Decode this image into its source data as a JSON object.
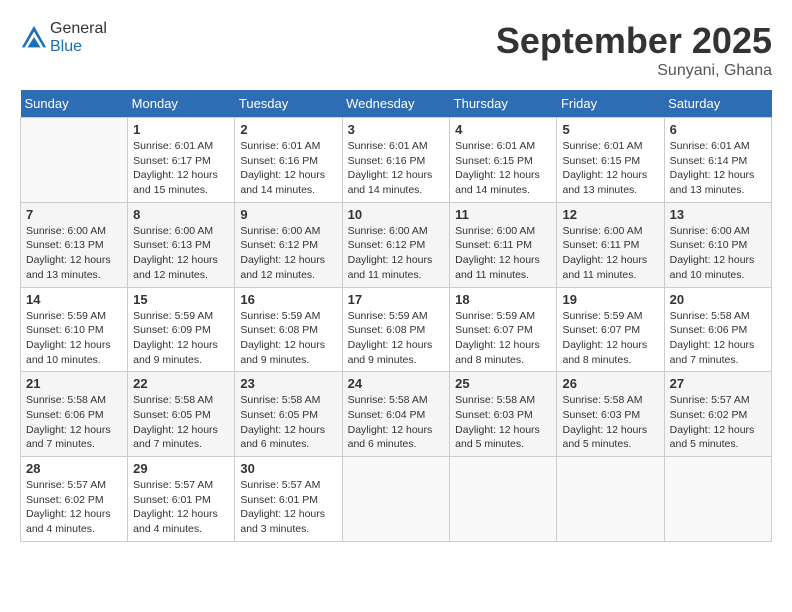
{
  "header": {
    "logo_general": "General",
    "logo_blue": "Blue",
    "month_title": "September 2025",
    "location": "Sunyani, Ghana"
  },
  "days_of_week": [
    "Sunday",
    "Monday",
    "Tuesday",
    "Wednesday",
    "Thursday",
    "Friday",
    "Saturday"
  ],
  "weeks": [
    [
      {
        "num": "",
        "sunrise": "",
        "sunset": "",
        "daylight": ""
      },
      {
        "num": "1",
        "sunrise": "Sunrise: 6:01 AM",
        "sunset": "Sunset: 6:17 PM",
        "daylight": "Daylight: 12 hours and 15 minutes."
      },
      {
        "num": "2",
        "sunrise": "Sunrise: 6:01 AM",
        "sunset": "Sunset: 6:16 PM",
        "daylight": "Daylight: 12 hours and 14 minutes."
      },
      {
        "num": "3",
        "sunrise": "Sunrise: 6:01 AM",
        "sunset": "Sunset: 6:16 PM",
        "daylight": "Daylight: 12 hours and 14 minutes."
      },
      {
        "num": "4",
        "sunrise": "Sunrise: 6:01 AM",
        "sunset": "Sunset: 6:15 PM",
        "daylight": "Daylight: 12 hours and 14 minutes."
      },
      {
        "num": "5",
        "sunrise": "Sunrise: 6:01 AM",
        "sunset": "Sunset: 6:15 PM",
        "daylight": "Daylight: 12 hours and 13 minutes."
      },
      {
        "num": "6",
        "sunrise": "Sunrise: 6:01 AM",
        "sunset": "Sunset: 6:14 PM",
        "daylight": "Daylight: 12 hours and 13 minutes."
      }
    ],
    [
      {
        "num": "7",
        "sunrise": "Sunrise: 6:00 AM",
        "sunset": "Sunset: 6:13 PM",
        "daylight": "Daylight: 12 hours and 13 minutes."
      },
      {
        "num": "8",
        "sunrise": "Sunrise: 6:00 AM",
        "sunset": "Sunset: 6:13 PM",
        "daylight": "Daylight: 12 hours and 12 minutes."
      },
      {
        "num": "9",
        "sunrise": "Sunrise: 6:00 AM",
        "sunset": "Sunset: 6:12 PM",
        "daylight": "Daylight: 12 hours and 12 minutes."
      },
      {
        "num": "10",
        "sunrise": "Sunrise: 6:00 AM",
        "sunset": "Sunset: 6:12 PM",
        "daylight": "Daylight: 12 hours and 11 minutes."
      },
      {
        "num": "11",
        "sunrise": "Sunrise: 6:00 AM",
        "sunset": "Sunset: 6:11 PM",
        "daylight": "Daylight: 12 hours and 11 minutes."
      },
      {
        "num": "12",
        "sunrise": "Sunrise: 6:00 AM",
        "sunset": "Sunset: 6:11 PM",
        "daylight": "Daylight: 12 hours and 11 minutes."
      },
      {
        "num": "13",
        "sunrise": "Sunrise: 6:00 AM",
        "sunset": "Sunset: 6:10 PM",
        "daylight": "Daylight: 12 hours and 10 minutes."
      }
    ],
    [
      {
        "num": "14",
        "sunrise": "Sunrise: 5:59 AM",
        "sunset": "Sunset: 6:10 PM",
        "daylight": "Daylight: 12 hours and 10 minutes."
      },
      {
        "num": "15",
        "sunrise": "Sunrise: 5:59 AM",
        "sunset": "Sunset: 6:09 PM",
        "daylight": "Daylight: 12 hours and 9 minutes."
      },
      {
        "num": "16",
        "sunrise": "Sunrise: 5:59 AM",
        "sunset": "Sunset: 6:08 PM",
        "daylight": "Daylight: 12 hours and 9 minutes."
      },
      {
        "num": "17",
        "sunrise": "Sunrise: 5:59 AM",
        "sunset": "Sunset: 6:08 PM",
        "daylight": "Daylight: 12 hours and 9 minutes."
      },
      {
        "num": "18",
        "sunrise": "Sunrise: 5:59 AM",
        "sunset": "Sunset: 6:07 PM",
        "daylight": "Daylight: 12 hours and 8 minutes."
      },
      {
        "num": "19",
        "sunrise": "Sunrise: 5:59 AM",
        "sunset": "Sunset: 6:07 PM",
        "daylight": "Daylight: 12 hours and 8 minutes."
      },
      {
        "num": "20",
        "sunrise": "Sunrise: 5:58 AM",
        "sunset": "Sunset: 6:06 PM",
        "daylight": "Daylight: 12 hours and 7 minutes."
      }
    ],
    [
      {
        "num": "21",
        "sunrise": "Sunrise: 5:58 AM",
        "sunset": "Sunset: 6:06 PM",
        "daylight": "Daylight: 12 hours and 7 minutes."
      },
      {
        "num": "22",
        "sunrise": "Sunrise: 5:58 AM",
        "sunset": "Sunset: 6:05 PM",
        "daylight": "Daylight: 12 hours and 7 minutes."
      },
      {
        "num": "23",
        "sunrise": "Sunrise: 5:58 AM",
        "sunset": "Sunset: 6:05 PM",
        "daylight": "Daylight: 12 hours and 6 minutes."
      },
      {
        "num": "24",
        "sunrise": "Sunrise: 5:58 AM",
        "sunset": "Sunset: 6:04 PM",
        "daylight": "Daylight: 12 hours and 6 minutes."
      },
      {
        "num": "25",
        "sunrise": "Sunrise: 5:58 AM",
        "sunset": "Sunset: 6:03 PM",
        "daylight": "Daylight: 12 hours and 5 minutes."
      },
      {
        "num": "26",
        "sunrise": "Sunrise: 5:58 AM",
        "sunset": "Sunset: 6:03 PM",
        "daylight": "Daylight: 12 hours and 5 minutes."
      },
      {
        "num": "27",
        "sunrise": "Sunrise: 5:57 AM",
        "sunset": "Sunset: 6:02 PM",
        "daylight": "Daylight: 12 hours and 5 minutes."
      }
    ],
    [
      {
        "num": "28",
        "sunrise": "Sunrise: 5:57 AM",
        "sunset": "Sunset: 6:02 PM",
        "daylight": "Daylight: 12 hours and 4 minutes."
      },
      {
        "num": "29",
        "sunrise": "Sunrise: 5:57 AM",
        "sunset": "Sunset: 6:01 PM",
        "daylight": "Daylight: 12 hours and 4 minutes."
      },
      {
        "num": "30",
        "sunrise": "Sunrise: 5:57 AM",
        "sunset": "Sunset: 6:01 PM",
        "daylight": "Daylight: 12 hours and 3 minutes."
      },
      {
        "num": "",
        "sunrise": "",
        "sunset": "",
        "daylight": ""
      },
      {
        "num": "",
        "sunrise": "",
        "sunset": "",
        "daylight": ""
      },
      {
        "num": "",
        "sunrise": "",
        "sunset": "",
        "daylight": ""
      },
      {
        "num": "",
        "sunrise": "",
        "sunset": "",
        "daylight": ""
      }
    ]
  ]
}
